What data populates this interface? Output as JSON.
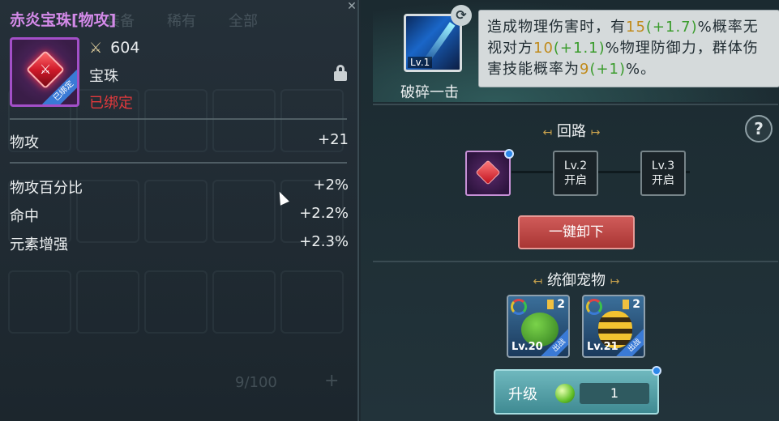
{
  "background_list": {
    "tabs": [
      "装备",
      "稀有"
    ],
    "filter": "全部",
    "count": "9/100"
  },
  "item": {
    "name": "赤炎宝珠[物攻]",
    "attack_value": "604",
    "type": "宝珠",
    "status": "已绑定",
    "icon_badge": "已绑定"
  },
  "stats": {
    "primary": {
      "label": "物攻",
      "value": "+21"
    },
    "secondary": [
      {
        "label": "物攻百分比",
        "value": "+2%"
      },
      {
        "label": "命中",
        "value": "+2.2%"
      },
      {
        "label": "元素增强",
        "value": "+2.3%"
      }
    ]
  },
  "skill": {
    "name": "破碎一击",
    "level": "Lv.1",
    "desc": {
      "p1": "造成物理伤害时，有",
      "v1": "15",
      "b1": "(+1.7)",
      "p2": "%概率无视对方",
      "v2": "10",
      "b2": "(+1.1)",
      "p3": "%物理防御力，群体伤害技能概率为",
      "v3": "9",
      "b3": "(+1)",
      "p4": "%。"
    }
  },
  "circuit": {
    "title": "回路",
    "slots": [
      {
        "level": "Lv.2",
        "state": "开启"
      },
      {
        "level": "Lv.3",
        "state": "开启"
      }
    ],
    "unequip_label": "一键卸下"
  },
  "pets": {
    "title": "统御宠物",
    "list": [
      {
        "level": "Lv.20",
        "stars": "2",
        "badge": "出战"
      },
      {
        "level": "Lv.21",
        "stars": "2",
        "badge": "出战"
      }
    ]
  },
  "upgrade": {
    "label": "升级",
    "count": "1"
  },
  "help_label": "?",
  "colors": {
    "item_name": "#d38ae8",
    "bound": "#e3393c",
    "highlight_value": "#c08a1a",
    "highlight_bonus": "#3a9c2c",
    "unequip_button": "#c04845",
    "upgrade_button": "#4f9aa2"
  },
  "icons": [
    "swords-icon",
    "lock-icon",
    "swap-icon",
    "help-icon",
    "gem-icon",
    "skill-icon",
    "orb-icon"
  ]
}
